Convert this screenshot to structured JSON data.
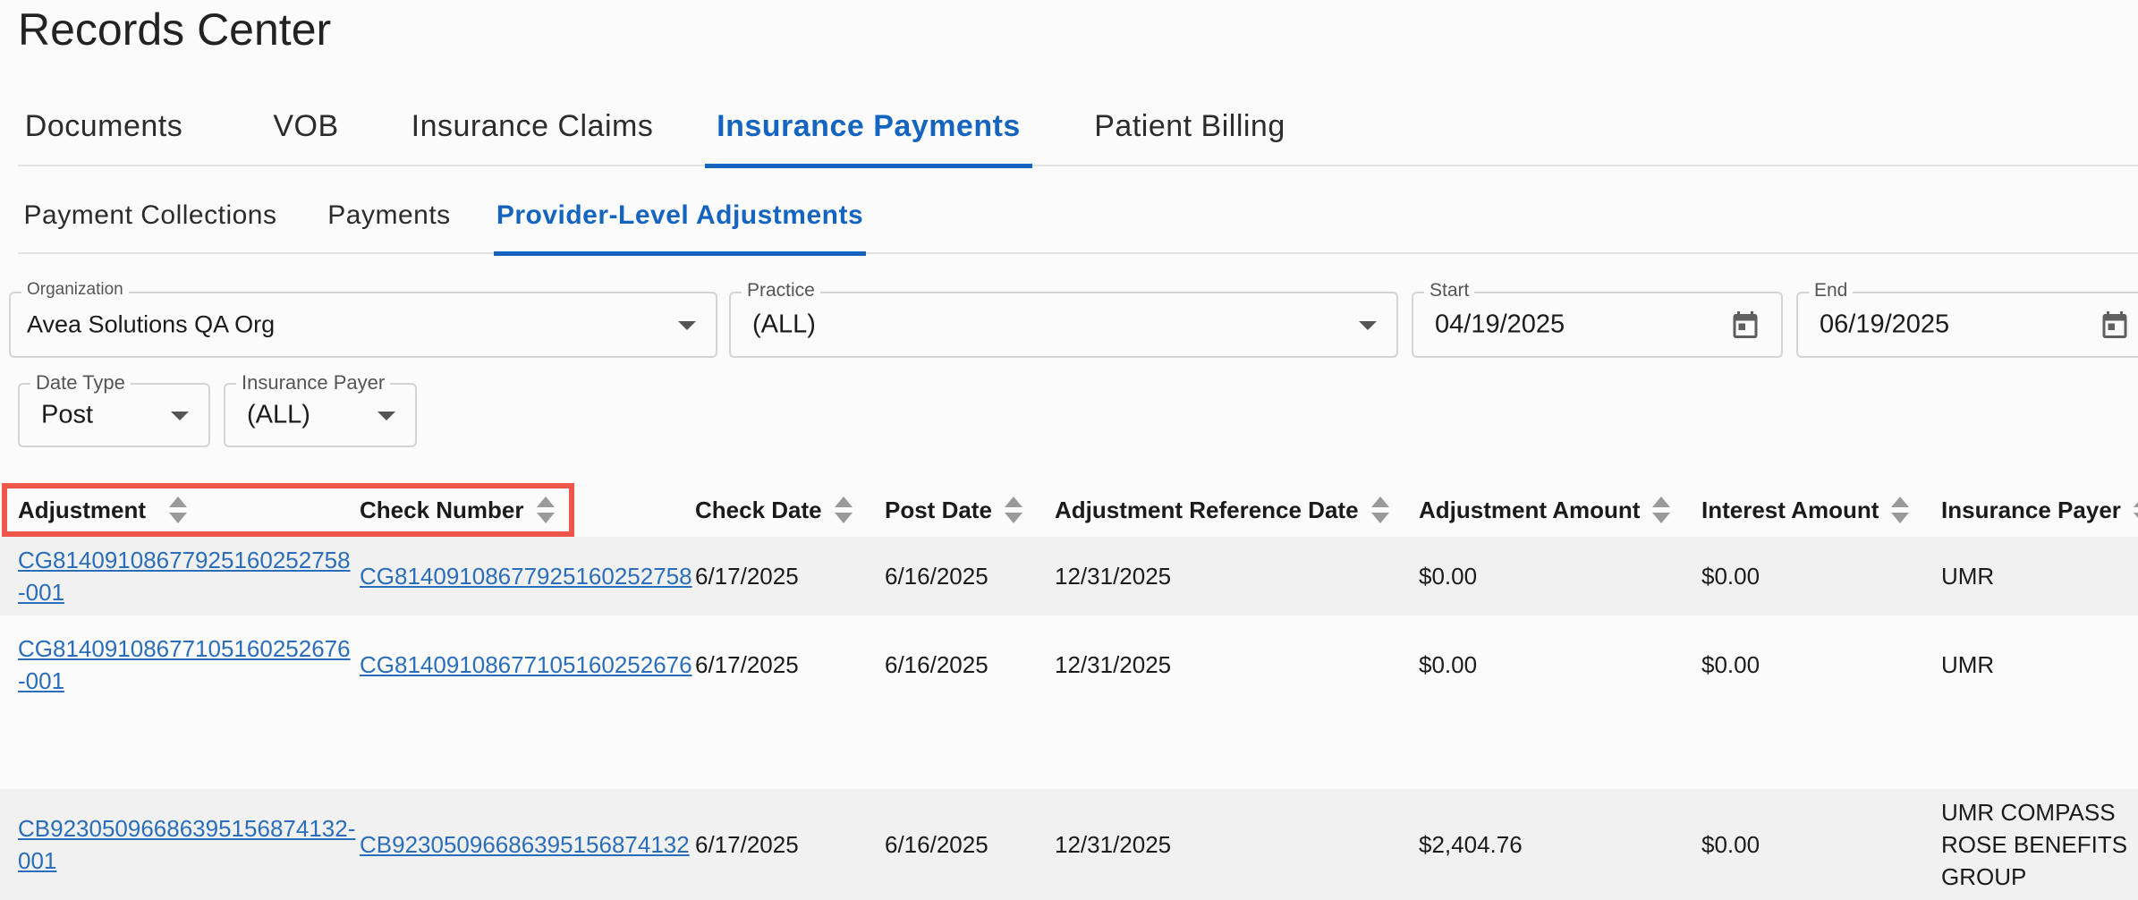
{
  "page": {
    "title": "Records Center"
  },
  "tabs": [
    "Documents",
    "VOB",
    "Insurance Claims",
    "Insurance Payments",
    "Patient Billing"
  ],
  "active_tab": "Insurance Payments",
  "subtabs": [
    "Payment Collections",
    "Payments",
    "Provider-Level Adjustments"
  ],
  "active_subtab": "Provider-Level Adjustments",
  "filters": {
    "organization": {
      "label": "Organization",
      "value": "Avea Solutions QA Org"
    },
    "practice": {
      "label": "Practice",
      "value": "(ALL)"
    },
    "start": {
      "label": "Start",
      "value": "04/19/2025"
    },
    "end": {
      "label": "End",
      "value": "06/19/2025"
    },
    "date_type": {
      "label": "Date Type",
      "value": "Post"
    },
    "insurance_payer": {
      "label": "Insurance Payer",
      "value": "(ALL)"
    }
  },
  "table": {
    "columns": [
      "Adjustment",
      "Check Number",
      "Check Date",
      "Post Date",
      "Adjustment Reference Date",
      "Adjustment Amount",
      "Interest Amount",
      "Insurance Payer"
    ],
    "rows": [
      {
        "adjustment": "CG81409108677925160252758-001",
        "check_number": "CG81409108677925160252758",
        "check_date": "6/17/2025",
        "post_date": "6/16/2025",
        "reference_date": "12/31/2025",
        "adjustment_amount": "$0.00",
        "interest_amount": "$0.00",
        "insurance_payer": "UMR"
      },
      {
        "adjustment": "CG81409108677105160252676-001",
        "check_number": "CG81409108677105160252676",
        "check_date": "6/17/2025",
        "post_date": "6/16/2025",
        "reference_date": "12/31/2025",
        "adjustment_amount": "$0.00",
        "interest_amount": "$0.00",
        "insurance_payer": "UMR"
      },
      {
        "adjustment": "CB92305096686395156874132-001",
        "check_number": "CB92305096686395156874132",
        "check_date": "6/17/2025",
        "post_date": "6/16/2025",
        "reference_date": "12/31/2025",
        "adjustment_amount": "$2,404.76",
        "interest_amount": "$0.00",
        "insurance_payer": "UMR COMPASS ROSE BENEFITS GROUP"
      }
    ]
  },
  "colors": {
    "accent": "#1565c0",
    "link": "#2a6ebb",
    "highlight": "#f0554a"
  }
}
